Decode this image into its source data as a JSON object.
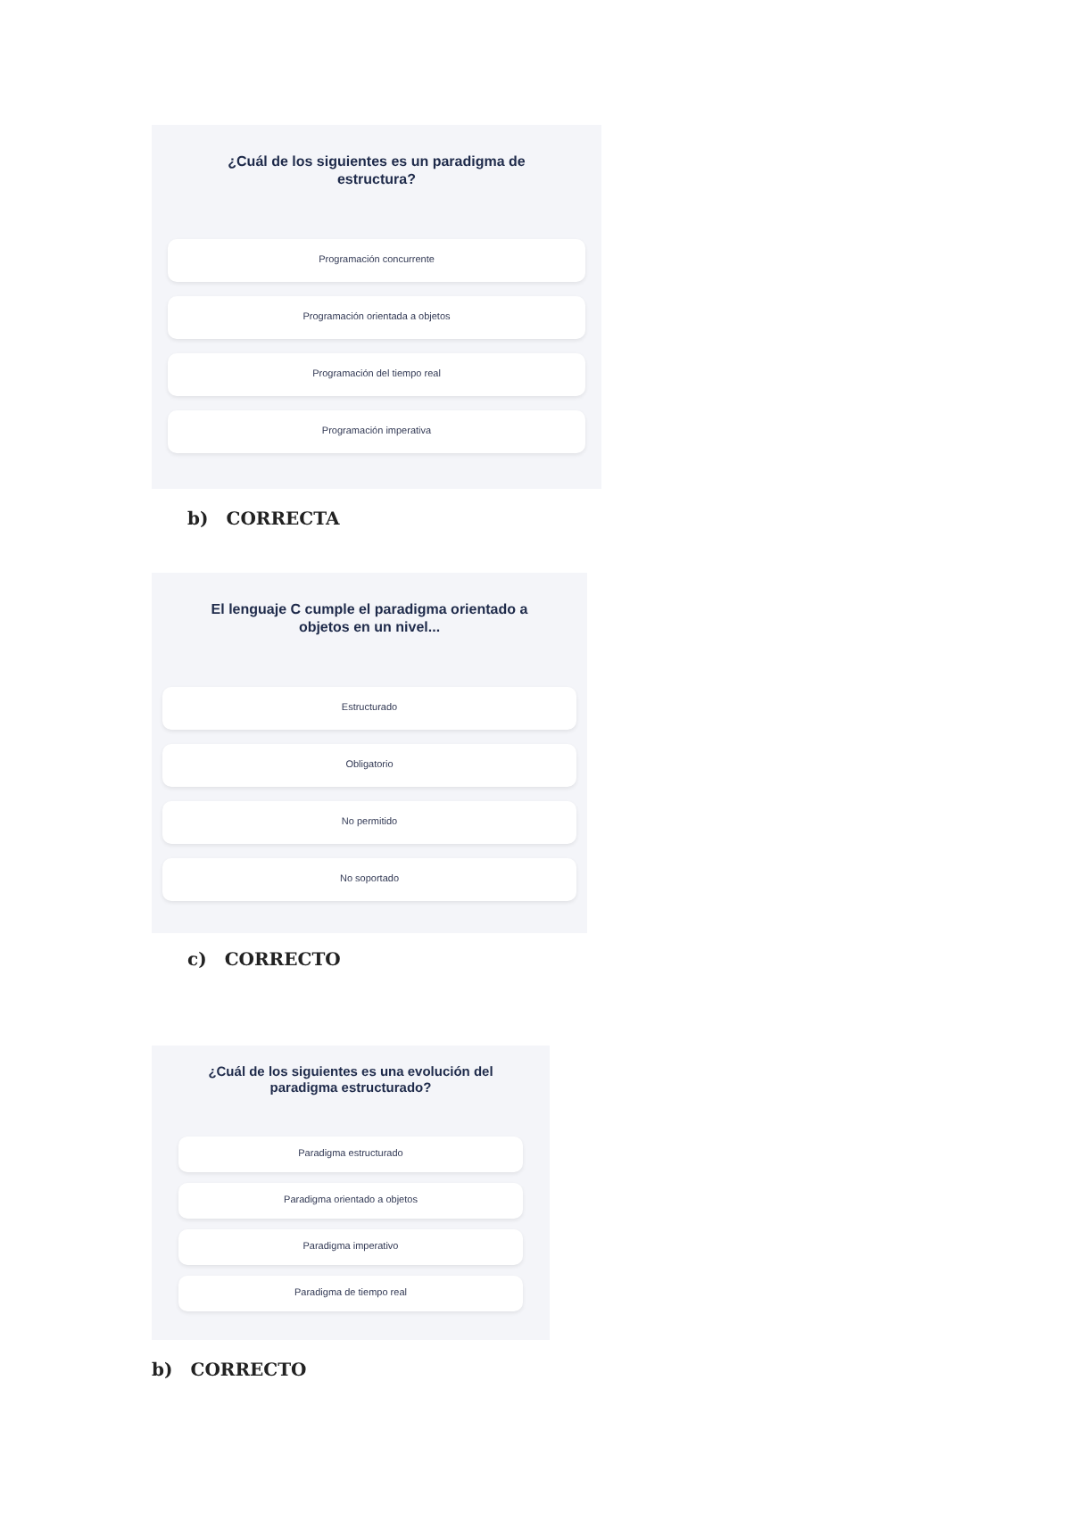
{
  "sections": [
    {
      "question": "¿Cuál de los siguientes es un paradigma de estructura?",
      "options": [
        "Programación concurrente",
        "Programación orientada a objetos",
        "Programación del tiempo real",
        "Programación imperativa"
      ],
      "answer": {
        "letter": "b)",
        "verdict": "CORRECTA",
        "indented": true
      }
    },
    {
      "question": "El lenguaje C cumple el paradigma orientado a objetos en un nivel...",
      "options": [
        "Estructurado",
        "Obligatorio",
        "No permitido",
        "No soportado"
      ],
      "answer": {
        "letter": "c)",
        "verdict": "CORRECTO",
        "indented": true
      }
    },
    {
      "question": "¿Cuál de los siguientes es una evolución del paradigma estructurado?",
      "options": [
        "Paradigma estructurado",
        "Paradigma orientado a objetos",
        "Paradigma imperativo",
        "Paradigma de tiempo real"
      ],
      "answer": {
        "letter": "b)",
        "verdict": "CORRECTO",
        "indented": false
      }
    }
  ]
}
